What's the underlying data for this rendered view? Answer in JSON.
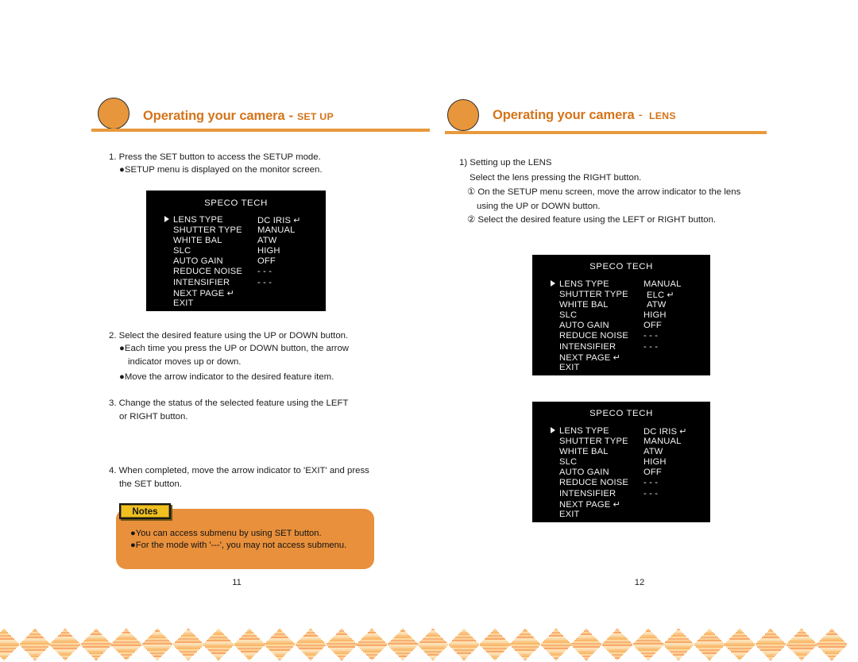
{
  "document": {
    "kind": "camera-manual-spread",
    "accent_color": "#e8963c",
    "rule_color": "#e8993c",
    "title_color": "#d4741a",
    "notes_fill": "#e8903c",
    "notes_tab_fill": "#f0c020",
    "osd_bg": "#000000",
    "osd_fg": "#f2f2f2"
  },
  "left_page": {
    "header": {
      "title_main": "Operating your camera",
      "dash": "-",
      "title_sub": "SET UP"
    },
    "steps": [
      {
        "text": "1. Press the SET button to access the SETUP mode."
      },
      {
        "text": "●SETUP menu is displayed on the monitor screen.",
        "indent": 12
      },
      {
        "text": "2. Select the desired feature using the UP or DOWN button."
      },
      {
        "text": "●Each time you press the UP or DOWN button, the arrow",
        "indent": 12
      },
      {
        "text": "indicator moves up or down.",
        "indent": 24
      },
      {
        "text": "●Move the arrow indicator to the desired feature item.",
        "indent": 12
      },
      {
        "text": "3. Change the status of the selected feature using the LEFT"
      },
      {
        "text": "or  RIGHT button.",
        "indent": 12
      },
      {
        "text": "4. When completed, move the arrow indicator to 'EXIT' and press"
      },
      {
        "text": "the SET button.",
        "indent": 12
      }
    ],
    "osd": {
      "title": "SPECO TECH",
      "rows": [
        {
          "label": "LENS TYPE",
          "value": "DC  IRIS",
          "enter": true,
          "arrow": true
        },
        {
          "label": "SHUTTER TYPE",
          "value": "MANUAL",
          "enter": false,
          "arrow": false
        },
        {
          "label": "WHITE  BAL",
          "value": "ATW",
          "enter": false,
          "arrow": false
        },
        {
          "label": "SLC",
          "value": "HIGH",
          "enter": false,
          "arrow": false
        },
        {
          "label": "AUTO  GAIN",
          "value": "OFF",
          "enter": false,
          "arrow": false
        },
        {
          "label": "REDUCE NOISE",
          "value": "- - -",
          "enter": false,
          "arrow": false
        },
        {
          "label": "INTENSIFIER",
          "value": "- - -",
          "enter": false,
          "arrow": false
        },
        {
          "label": "NEXT  PAGE",
          "value": "",
          "enter": true,
          "arrow": false,
          "enter_inline": true
        },
        {
          "label": "EXIT",
          "value": "",
          "enter": false,
          "arrow": false
        }
      ]
    },
    "notes": {
      "tab_label": "Notes",
      "lines": [
        "●You can access submenu by using SET button.",
        "●For the mode with '---', you may not access submenu."
      ]
    },
    "page_number": "11"
  },
  "right_page": {
    "header": {
      "title_main": "Operating your camera",
      "dash": "-",
      "title_sub": "LENS"
    },
    "steps": [
      {
        "text": "1) Setting up the LENS"
      },
      {
        "text": "Select the lens pressing the RIGHT button.",
        "indent": 8
      },
      {
        "text": "① On the SETUP menu screen, move the arrow indicator to the lens",
        "indent": 14
      },
      {
        "text": "using the UP or DOWN button.",
        "indent": 26
      },
      {
        "text": "② Select the desired feature using the LEFT or RIGHT button.",
        "indent": 14
      }
    ],
    "osd_top": {
      "title": "SPECO TECH",
      "rows": [
        {
          "label": "LENS TYPE",
          "value": "MANUAL",
          "enter": false,
          "arrow": true
        },
        {
          "label": "SHUTTER TYPE",
          "value": "ELC",
          "enter": true,
          "arrow": false
        },
        {
          "label": "WHITE  BAL",
          "value": "ATW",
          "enter": false,
          "arrow": false
        },
        {
          "label": "SLC",
          "value": "HIGH",
          "enter": false,
          "arrow": false
        },
        {
          "label": "AUTO  GAIN",
          "value": "OFF",
          "enter": false,
          "arrow": false
        },
        {
          "label": "REDUCE NOISE",
          "value": "- - -",
          "enter": false,
          "arrow": false
        },
        {
          "label": "INTENSIFIER",
          "value": "- - -",
          "enter": false,
          "arrow": false
        },
        {
          "label": "NEXT  PAGE",
          "value": "",
          "enter": true,
          "arrow": false,
          "enter_inline": true
        },
        {
          "label": "EXIT",
          "value": "",
          "enter": false,
          "arrow": false
        }
      ]
    },
    "osd_bottom": {
      "title": "SPECO TECH",
      "rows": [
        {
          "label": "LENS TYPE",
          "value": "DC  IRIS",
          "enter": true,
          "arrow": true
        },
        {
          "label": "SHUTTER TYPE",
          "value": "MANUAL",
          "enter": false,
          "arrow": false
        },
        {
          "label": "WHITE  BAL",
          "value": "ATW",
          "enter": false,
          "arrow": false
        },
        {
          "label": "SLC",
          "value": "HIGH",
          "enter": false,
          "arrow": false
        },
        {
          "label": "AUTO  GAIN",
          "value": "OFF",
          "enter": false,
          "arrow": false
        },
        {
          "label": "REDUCE NOISE",
          "value": "- - -",
          "enter": false,
          "arrow": false
        },
        {
          "label": "INTENSIFIER",
          "value": "- - -",
          "enter": false,
          "arrow": false
        },
        {
          "label": "NEXT  PAGE",
          "value": "",
          "enter": true,
          "arrow": false,
          "enter_inline": true
        },
        {
          "label": "EXIT",
          "value": "",
          "enter": false,
          "arrow": false
        }
      ]
    },
    "page_number": "12"
  },
  "decoration": {
    "band_colors": [
      "#fbd9a6",
      "#f9c583",
      "#fab96a",
      "#fdd9a2",
      "#f7b277",
      "#fccf94",
      "#f8a86a",
      "#fde3b8"
    ],
    "diamond_count": 28
  }
}
